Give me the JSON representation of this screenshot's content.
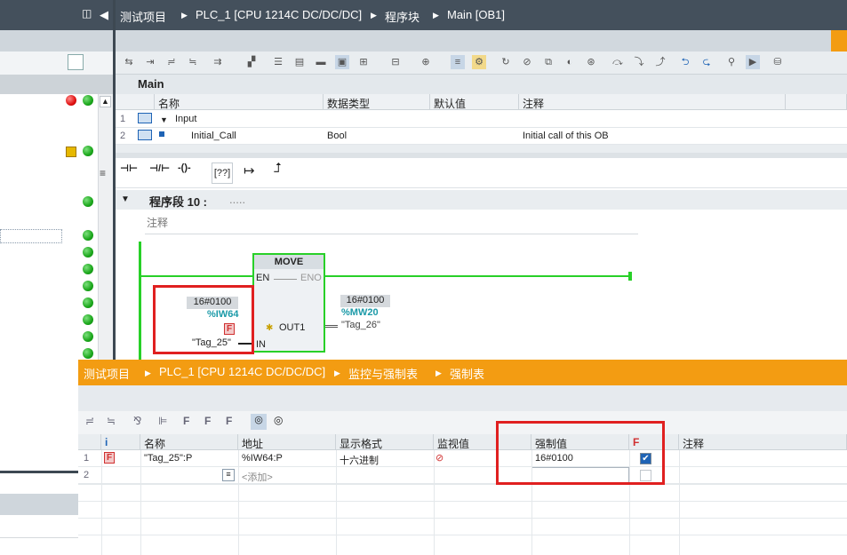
{
  "breadcrumb_top": {
    "project": "测试项目",
    "plc": "PLC_1 [CPU 1214C DC/DC/DC]",
    "folder": "程序块",
    "block": "Main [OB1]"
  },
  "editor": {
    "block_name": "Main",
    "interface_headers": [
      "名称",
      "数据类型",
      "默认值",
      "注释"
    ],
    "interface_rows": [
      {
        "num": "1",
        "name": "Input",
        "type": "",
        "default": "",
        "comment": ""
      },
      {
        "num": "2",
        "name": "Initial_Call",
        "type": "Bool",
        "default": "",
        "comment": "Initial call of this OB"
      }
    ],
    "ladder_tools": [
      "⊣⊢",
      "⊣/⊢",
      "-()-",
      "[??]",
      "↦",
      "⮥"
    ],
    "segment_title": "程序段 10 :",
    "segment_dots": ".....",
    "comment_label": "注释",
    "move_block": {
      "title": "MOVE",
      "en": "EN",
      "eno": "ENO",
      "in": "IN",
      "out": "OUT1",
      "in_value": "16#0100",
      "in_address": "%IW64",
      "in_force_flag": "F",
      "in_tag": "\"Tag_25\"",
      "out_value": "16#0100",
      "out_address": "%MW20",
      "out_tag": "\"Tag_26\""
    }
  },
  "breadcrumb_bottom": {
    "project": "测试项目",
    "plc": "PLC_1 [CPU 1214C DC/DC/DC]",
    "folder": "监控与强制表",
    "table": "强制表"
  },
  "force_table": {
    "headers": [
      "i",
      "名称",
      "地址",
      "显示格式",
      "监视值",
      "强制值",
      "F",
      "注释"
    ],
    "rows": [
      {
        "num": "1",
        "flag": "F",
        "name": "\"Tag_25\":P",
        "address": "%IW64:P",
        "format": "十六进制",
        "force_value": "16#0100",
        "checked": true
      },
      {
        "num": "2",
        "name": "",
        "address": "<添加>",
        "format": "",
        "force_value": "",
        "checked": false
      }
    ]
  },
  "colors": {
    "accent_orange": "#f39c12",
    "status_green": "#1aa61a",
    "highlight_red": "#e02020",
    "dark_bar": "#44505c"
  }
}
